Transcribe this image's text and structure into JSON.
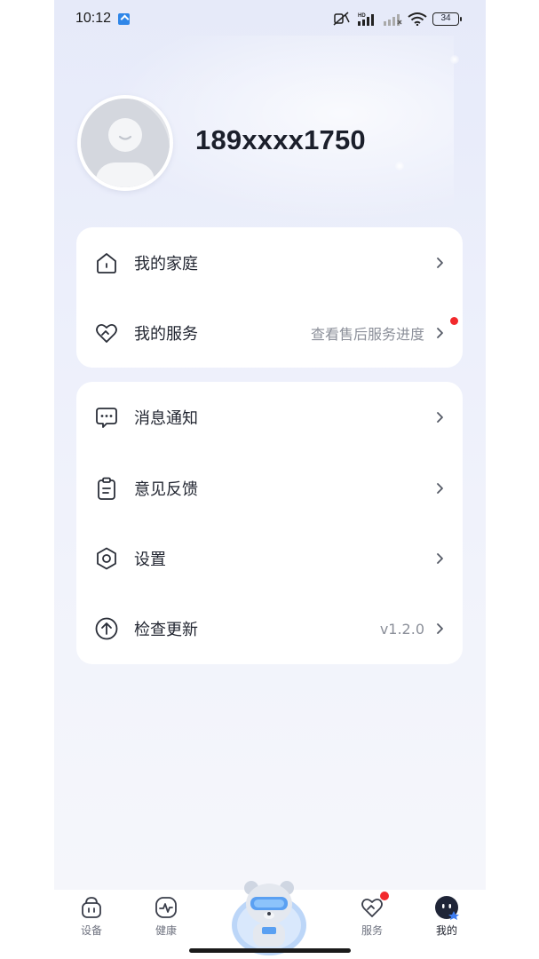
{
  "status_bar": {
    "time": "10:12",
    "network_label": "HD",
    "battery": "34"
  },
  "profile": {
    "phone_number": "189xxxx1750"
  },
  "card_1": {
    "items": [
      {
        "label": "我的家庭",
        "icon": "home-icon"
      },
      {
        "label": "我的服务",
        "icon": "heart-service-icon",
        "sub": "查看售后服务进度",
        "badge": true
      }
    ]
  },
  "card_2": {
    "items": [
      {
        "label": "消息通知",
        "icon": "message-icon"
      },
      {
        "label": "意见反馈",
        "icon": "clipboard-icon"
      },
      {
        "label": "设置",
        "icon": "settings-hexagon-icon"
      },
      {
        "label": "检查更新",
        "icon": "update-arrow-icon",
        "sub": "v1.2.0"
      }
    ]
  },
  "bottom_nav": {
    "items": [
      {
        "label": "设备",
        "icon": "device-icon"
      },
      {
        "label": "健康",
        "icon": "health-icon"
      },
      {
        "label": "",
        "icon": "robot-bear-mascot-icon"
      },
      {
        "label": "服务",
        "icon": "service-heart-icon",
        "badge": true
      },
      {
        "label": "我的",
        "icon": "profile-avatar-icon",
        "active": true
      }
    ]
  },
  "colors": {
    "accent_red": "#f2292c",
    "text_primary": "#222631",
    "text_secondary": "#8b8f99",
    "background_top": "#e6eaf9"
  }
}
